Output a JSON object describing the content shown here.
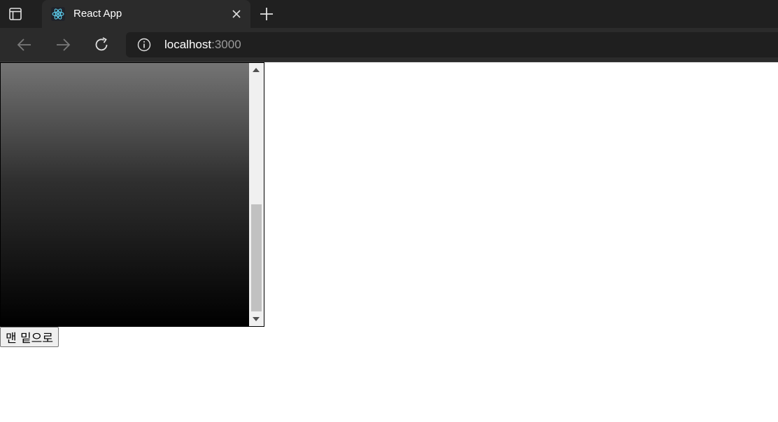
{
  "browser": {
    "tab": {
      "title": "React App"
    },
    "address": {
      "host": "localhost",
      "port": ":3000"
    }
  },
  "page": {
    "button_label": "맨 밑으로",
    "scroll_position": 0.55
  }
}
